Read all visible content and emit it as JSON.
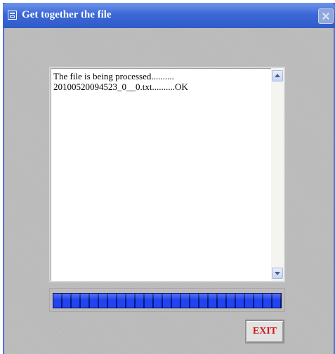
{
  "window": {
    "title": "Get together the file"
  },
  "log": {
    "lines": [
      "The file is being processed..........",
      "20100520094523_0__0.txt..........OK"
    ]
  },
  "progress": {
    "percent": 100
  },
  "buttons": {
    "exit_label": "EXIT"
  },
  "colors": {
    "titlebar": "#3b68d6",
    "progress_fill": "#1f44f0",
    "exit_text": "#d01414"
  }
}
